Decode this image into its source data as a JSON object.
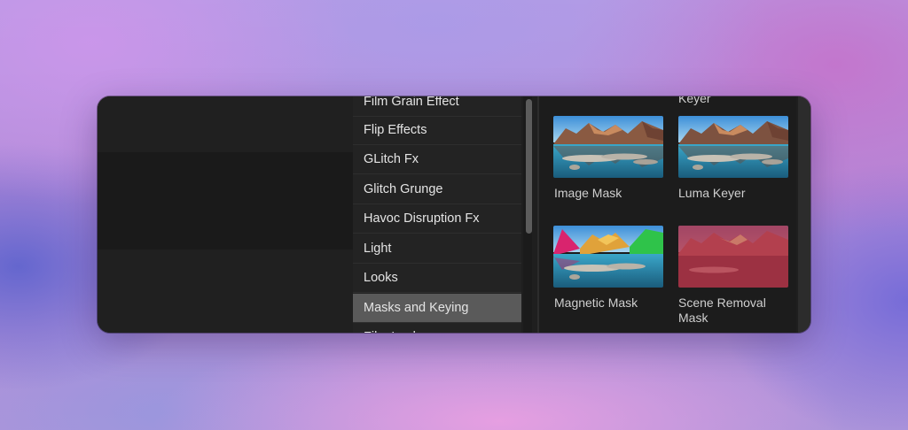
{
  "categories": [
    {
      "label": "Film Grain Effect",
      "selected": false
    },
    {
      "label": "Flip Effects",
      "selected": false
    },
    {
      "label": "GLitch Fx",
      "selected": false
    },
    {
      "label": "Glitch Grunge",
      "selected": false
    },
    {
      "label": "Havoc Disruption Fx",
      "selected": false
    },
    {
      "label": "Light",
      "selected": false
    },
    {
      "label": "Looks",
      "selected": false
    },
    {
      "label": "Masks and Keying",
      "selected": true
    },
    {
      "label": "Film Looks",
      "selected": false
    }
  ],
  "effects": {
    "partial_label": "Keyer",
    "items": [
      {
        "label": "Image Mask",
        "thumb_icon": "landscape-thumbnail"
      },
      {
        "label": "Luma Keyer",
        "thumb_icon": "landscape-thumbnail"
      },
      {
        "label": "Magnetic Mask",
        "thumb_icon": "landscape-thumbnail-tinted-magenta-green"
      },
      {
        "label": "Scene Removal Mask",
        "thumb_icon": "landscape-thumbnail-tinted-red"
      }
    ]
  }
}
